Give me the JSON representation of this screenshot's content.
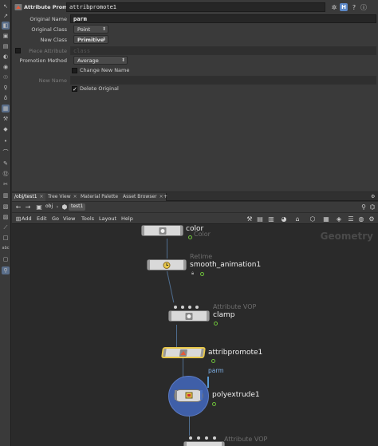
{
  "param_pane": {
    "node_type_label": "Attribute Promote",
    "node_name": "attribpromote1",
    "header_icons": [
      "gear-icon",
      "help-icon",
      "info-icon"
    ],
    "h_badge": "H",
    "params": {
      "original_name": {
        "label": "Original Name",
        "value": "parm"
      },
      "original_class": {
        "label": "Original Class",
        "value": "Point"
      },
      "new_class": {
        "label": "New Class",
        "value": "Primitive"
      },
      "piece_attribute": {
        "label": "Piece Attribute",
        "value": "class"
      },
      "promotion_method": {
        "label": "Promotion Method",
        "value": "Average"
      },
      "change_new_name": {
        "label": "Change New Name",
        "checked": false
      },
      "new_name": {
        "label": "New Name",
        "value": ""
      },
      "delete_original": {
        "label": "Delete Original",
        "checked": true
      }
    }
  },
  "network_pane": {
    "tabs": [
      {
        "label": "/obj/test1",
        "active": true
      },
      {
        "label": "Tree View",
        "active": false
      },
      {
        "label": "Material Palette",
        "active": false
      },
      {
        "label": "Asset Browser",
        "active": false
      }
    ],
    "path": [
      "obj",
      "test1"
    ],
    "menu": [
      "Add",
      "Edit",
      "Go",
      "View",
      "Tools",
      "Layout",
      "Help"
    ],
    "context_label": "Geometry",
    "nodes": [
      {
        "name": "color",
        "type": "Color"
      },
      {
        "name": "smooth_animation1",
        "type": "Retime"
      },
      {
        "name": "clamp",
        "type": "Attribute VOP"
      },
      {
        "name": "attribpromote1",
        "type": "",
        "attribute": "parm"
      },
      {
        "name": "polyextrude1",
        "type": ""
      },
      {
        "name": "",
        "type": "Attribute VOP"
      }
    ]
  }
}
